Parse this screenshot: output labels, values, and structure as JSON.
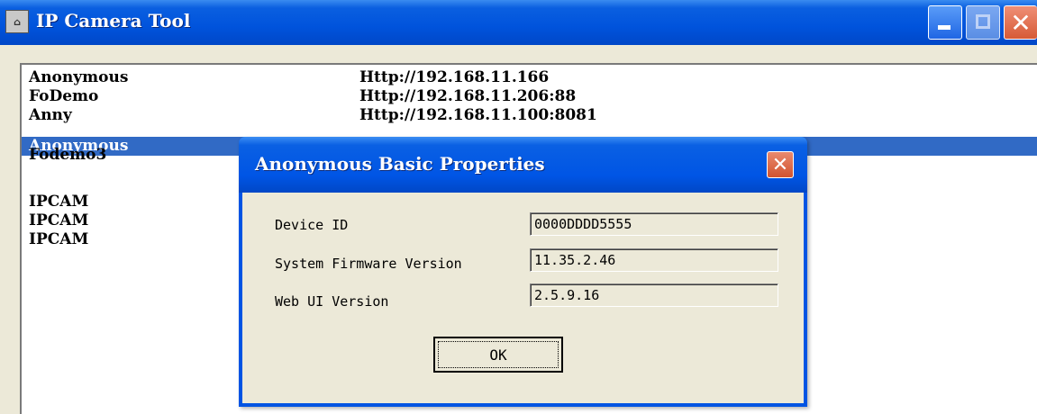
{
  "window": {
    "title": "IP Camera Tool",
    "icon": "app-icon"
  },
  "cameras": [
    {
      "name": "Anonymous",
      "url": "Http://192.168.11.166"
    },
    {
      "name": "FoDemo",
      "url": "Http://192.168.11.206:88"
    },
    {
      "name": "Anny",
      "url": "Http://192.168.11.100:8081"
    },
    {
      "name": "Anonymous",
      "url": "",
      "selected": true
    },
    {
      "name": "Fodemo3",
      "url": ""
    },
    {
      "name": "IPCAM",
      "url": ""
    },
    {
      "name": "IPCAM",
      "url": ""
    },
    {
      "name": "IPCAM",
      "url": ""
    }
  ],
  "dialog": {
    "title": "Anonymous Basic Properties",
    "device_id_label": "Device ID",
    "device_id_value": "0000DDDD5555",
    "firmware_label": "System Firmware Version",
    "firmware_value": "11.35.2.46",
    "webui_label": "Web UI Version",
    "webui_value": "2.5.9.16",
    "ok_label": "OK"
  },
  "colors": {
    "titlebar": "#0054e3",
    "selection": "#316ac5",
    "face": "#ece9d8"
  }
}
